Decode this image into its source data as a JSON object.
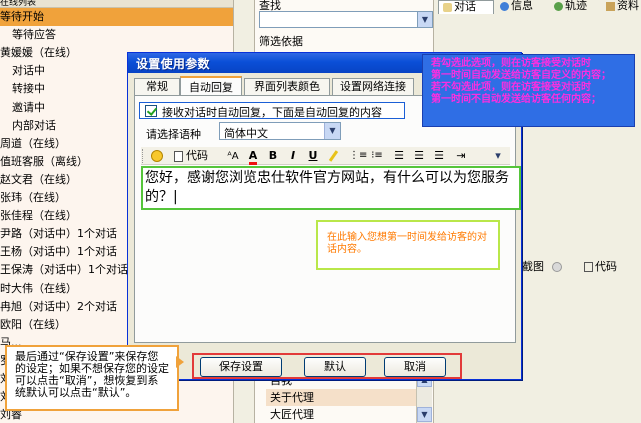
{
  "left_header": "在线列表",
  "visitors": [
    {
      "label": "等待开始",
      "selected": true
    },
    {
      "label": "等待应答",
      "indent": true
    },
    {
      "label": "黄媛媛（在线）"
    },
    {
      "label": "对话中",
      "indent": true
    },
    {
      "label": "转接中",
      "indent": true
    },
    {
      "label": "邀请中",
      "indent": true
    },
    {
      "label": "内部对话",
      "indent": true
    },
    {
      "label": "周道（在线）"
    },
    {
      "label": "值班客服（离线）"
    },
    {
      "label": "赵文君（在线）"
    },
    {
      "label": "张玮（在线）"
    },
    {
      "label": "张佳程（在线）"
    },
    {
      "label": "尹路（对话中）1个对话"
    },
    {
      "label": "王杨（对话中）1个对话"
    },
    {
      "label": "王保涛（对话中）1个对话"
    },
    {
      "label": "时大伟（在线）"
    },
    {
      "label": "冉旭（对话中）2个对话"
    },
    {
      "label": "欧阳（在线）"
    },
    {
      "label": "马..."
    },
    {
      "label": "罗..."
    },
    {
      "label": "刘..."
    },
    {
      "label": "刘..."
    },
    {
      "label": "刘睿"
    }
  ],
  "middle": {
    "search_label": "查找",
    "filter_label": "筛选依据",
    "bottom_items": [
      "自我",
      "关于代理",
      "大匠代理"
    ]
  },
  "right": {
    "tabs": [
      "对话",
      "信息",
      "轨迹",
      "资料"
    ],
    "tool_labels": [
      "截图",
      "代码"
    ]
  },
  "dialog": {
    "title": "设置使用参数",
    "tabs": [
      "常规",
      "自动回复",
      "界面列表颜色",
      "设置网络连接"
    ],
    "active_tab": 1,
    "auto_reply_checkbox": "接收对话时自动回复，下面是自动回复的内容",
    "auto_reply_checked": true,
    "language_label": "请选择语种",
    "language_value": "简体中文",
    "toolbar": {
      "code": "代码",
      "bold": "B",
      "italic": "I",
      "underline": "U"
    },
    "reply_text": "您好，感谢您浏览忠仕软件官方网站，有什么可以为您服务的？|",
    "buttons": {
      "save": "保存设置",
      "default": "默认",
      "cancel": "取消"
    }
  },
  "notes": {
    "top_right": [
      "若勾选此选项，则在访客接受对话时",
      "第一时间自动发送给访客自定义的内容；",
      "若不勾选此项，则在访客接受对话时",
      "第一时间不自动发送给访客任何内容；"
    ],
    "middle": "在此输入您想第一时间发给访客的对话内容。",
    "bottom_left": "最后通过“保存设置”来保存您的设定；如果不想保存您的设定可以点击“取消”，想恢复到系统默认可以点击“默认”。"
  },
  "colors": {
    "title_bar": "#0a4fd7",
    "selected_row": "#f0a23b",
    "callout_blue": "#2f6ee5",
    "callout_text_pink": "#ff2de0",
    "editor_border": "#55c53a",
    "button_bar_border": "#e23a3a"
  }
}
